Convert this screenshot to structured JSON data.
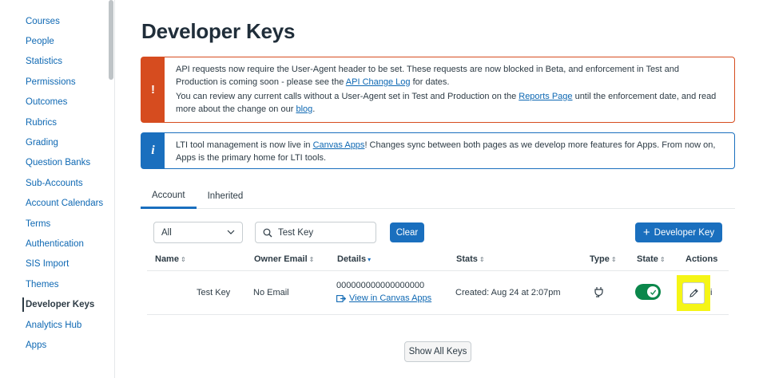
{
  "sidebar": {
    "items": [
      {
        "label": "Courses"
      },
      {
        "label": "People"
      },
      {
        "label": "Statistics"
      },
      {
        "label": "Permissions"
      },
      {
        "label": "Outcomes"
      },
      {
        "label": "Rubrics"
      },
      {
        "label": "Grading"
      },
      {
        "label": "Question Banks"
      },
      {
        "label": "Sub-Accounts"
      },
      {
        "label": "Account Calendars"
      },
      {
        "label": "Terms"
      },
      {
        "label": "Authentication"
      },
      {
        "label": "SIS Import"
      },
      {
        "label": "Themes"
      },
      {
        "label": "Developer Keys",
        "active": true
      },
      {
        "label": "Analytics Hub"
      },
      {
        "label": "Apps"
      }
    ]
  },
  "page": {
    "title": "Developer Keys"
  },
  "alerts": {
    "warning": {
      "icon": "exclamation-icon",
      "icon_glyph": "!",
      "p1_a": "API requests now require the User-Agent header to be set. These requests are now blocked in Beta, and enforcement in Test and Production is coming soon - please see the ",
      "p1_link": "API Change Log",
      "p1_b": " for dates.",
      "p2_a": "You can review any current calls without a User-Agent set in Test and Production on the ",
      "p2_link": "Reports Page",
      "p2_b": " until the enforcement date, and read more about the change on our ",
      "p2_link2": "blog",
      "p2_c": "."
    },
    "info": {
      "icon": "info-icon",
      "icon_glyph": "i",
      "text_a": "LTI tool management is now live in ",
      "link": "Canvas Apps",
      "text_b": "! Changes sync between both pages as we develop more features for Apps. From now on, Apps is the primary home for LTI tools."
    }
  },
  "tabs": [
    {
      "label": "Account",
      "active": true
    },
    {
      "label": "Inherited",
      "active": false
    }
  ],
  "toolbar": {
    "filter_value": "All",
    "search_value": "Test Key",
    "clear_label": "Clear",
    "add_label": "Developer Key",
    "add_icon": "+"
  },
  "table": {
    "headers": {
      "name": "Name",
      "owner_email": "Owner Email",
      "details": "Details",
      "stats": "Stats",
      "type": "Type",
      "state": "State",
      "actions": "Actions"
    },
    "sort_glyph": "⇕",
    "sort_active_glyph": "▾",
    "rows": [
      {
        "name": "Test Key",
        "owner_email": "No Email",
        "key_id": "000000000000000000",
        "view_link": "View in Canvas Apps",
        "stats": "Created: Aug 24 at 2:07pm",
        "type_icon": "plug-icon",
        "state_on": true,
        "more": "i"
      }
    ]
  },
  "footer": {
    "show_all_label": "Show All Keys"
  },
  "colors": {
    "brand_blue": "#1a6fbe",
    "warning": "#d64c1f",
    "success": "#0b874b",
    "highlight": "#f5f516"
  }
}
